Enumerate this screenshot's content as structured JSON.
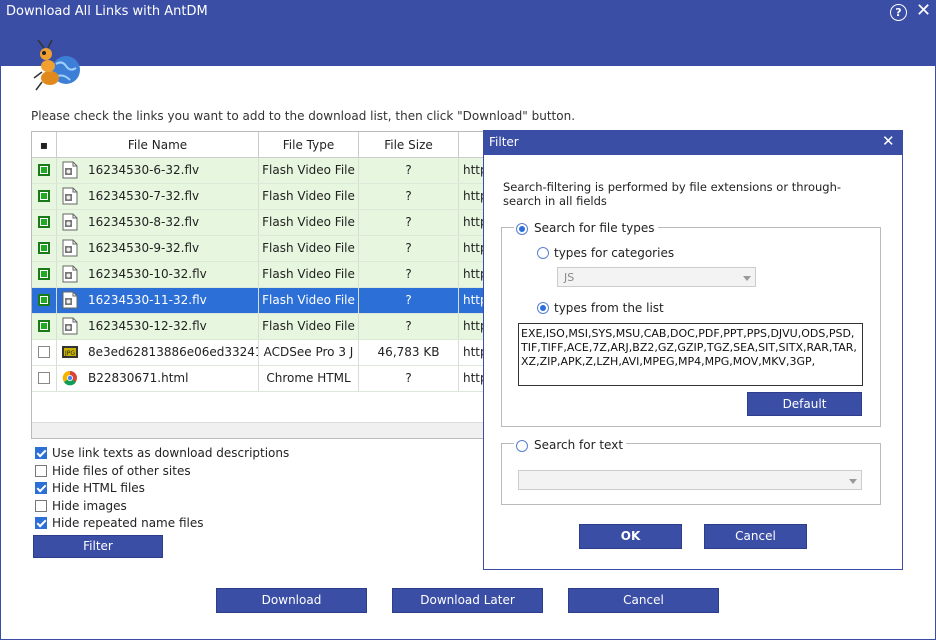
{
  "window": {
    "title": "Download All Links with AntDM",
    "help_glyph": "?",
    "close_glyph": "✕",
    "instruction": "Please check the links you want to add to the download list, then click \"Download\" button."
  },
  "table": {
    "columns": [
      "▪",
      "File Name",
      "File Type",
      "File Size",
      "",
      "htt"
    ],
    "rows": [
      {
        "checked": true,
        "name": "16234530-6-32.flv",
        "type": "Flash Video File",
        "size": "?",
        "url": "http",
        "icon": "flash-file-icon",
        "state": "checked"
      },
      {
        "checked": true,
        "name": "16234530-7-32.flv",
        "type": "Flash Video File",
        "size": "?",
        "url": "http",
        "icon": "flash-file-icon",
        "state": "checked"
      },
      {
        "checked": true,
        "name": "16234530-8-32.flv",
        "type": "Flash Video File",
        "size": "?",
        "url": "http",
        "icon": "flash-file-icon",
        "state": "checked"
      },
      {
        "checked": true,
        "name": "16234530-9-32.flv",
        "type": "Flash Video File",
        "size": "?",
        "url": "http",
        "icon": "flash-file-icon",
        "state": "checked"
      },
      {
        "checked": true,
        "name": "16234530-10-32.flv",
        "type": "Flash Video File",
        "size": "?",
        "url": "http",
        "icon": "flash-file-icon",
        "state": "checked"
      },
      {
        "checked": true,
        "name": "16234530-11-32.flv",
        "type": "Flash Video File",
        "size": "?",
        "url": "http",
        "icon": "flash-file-icon",
        "state": "selected"
      },
      {
        "checked": true,
        "name": "16234530-12-32.flv",
        "type": "Flash Video File",
        "size": "?",
        "url": "http",
        "icon": "flash-file-icon",
        "state": "checked"
      },
      {
        "checked": false,
        "name": "8e3ed62813886e06ed33241",
        "type": "ACDSee Pro 3 J",
        "size": "46,783 KB",
        "url": "http",
        "icon": "image-file-icon",
        "state": "unchecked"
      },
      {
        "checked": false,
        "name": "B22830671.html",
        "type": "Chrome HTML",
        "size": "?",
        "url": "http",
        "icon": "chrome-icon",
        "state": "unchecked"
      }
    ]
  },
  "options": [
    {
      "label": "Use link texts as download descriptions",
      "checked": true
    },
    {
      "label": "Hide files of other sites",
      "checked": false
    },
    {
      "label": "Hide HTML files",
      "checked": true
    },
    {
      "label": "Hide images",
      "checked": false
    },
    {
      "label": "Hide repeated name files",
      "checked": true
    }
  ],
  "buttons": {
    "filter": "Filter",
    "download": "Download",
    "download_later": "Download Later",
    "cancel": "Cancel"
  },
  "filter_dialog": {
    "title": "Filter",
    "close_glyph": "✕",
    "description": "Search-filtering is performed by file extensions or through-search in all fields",
    "search_types_label": "Search for file types",
    "types_categories_label": "types for categories",
    "category_value": "JS",
    "types_list_label": "types from the list",
    "types_list_value": "EXE,ISO,MSI,SYS,MSU,CAB,DOC,PDF,PPT,PPS,DJVU,ODS,PSD,TIF,TIFF,ACE,7Z,ARJ,BZ2,GZ,GZIP,TGZ,SEA,SIT,SITX,RAR,TAR,XZ,ZIP,APK,Z,LZH,AVI,MPEG,MP4,MPG,MOV,MKV,3GP,",
    "default_button": "Default",
    "search_text_label": "Search for text",
    "search_text_value": "",
    "ok_button": "OK",
    "cancel_button": "Cancel"
  },
  "colors": {
    "accent": "#3b4ea6",
    "checked_row": "#e6f6df",
    "selected_row": "#2c6fd6"
  }
}
